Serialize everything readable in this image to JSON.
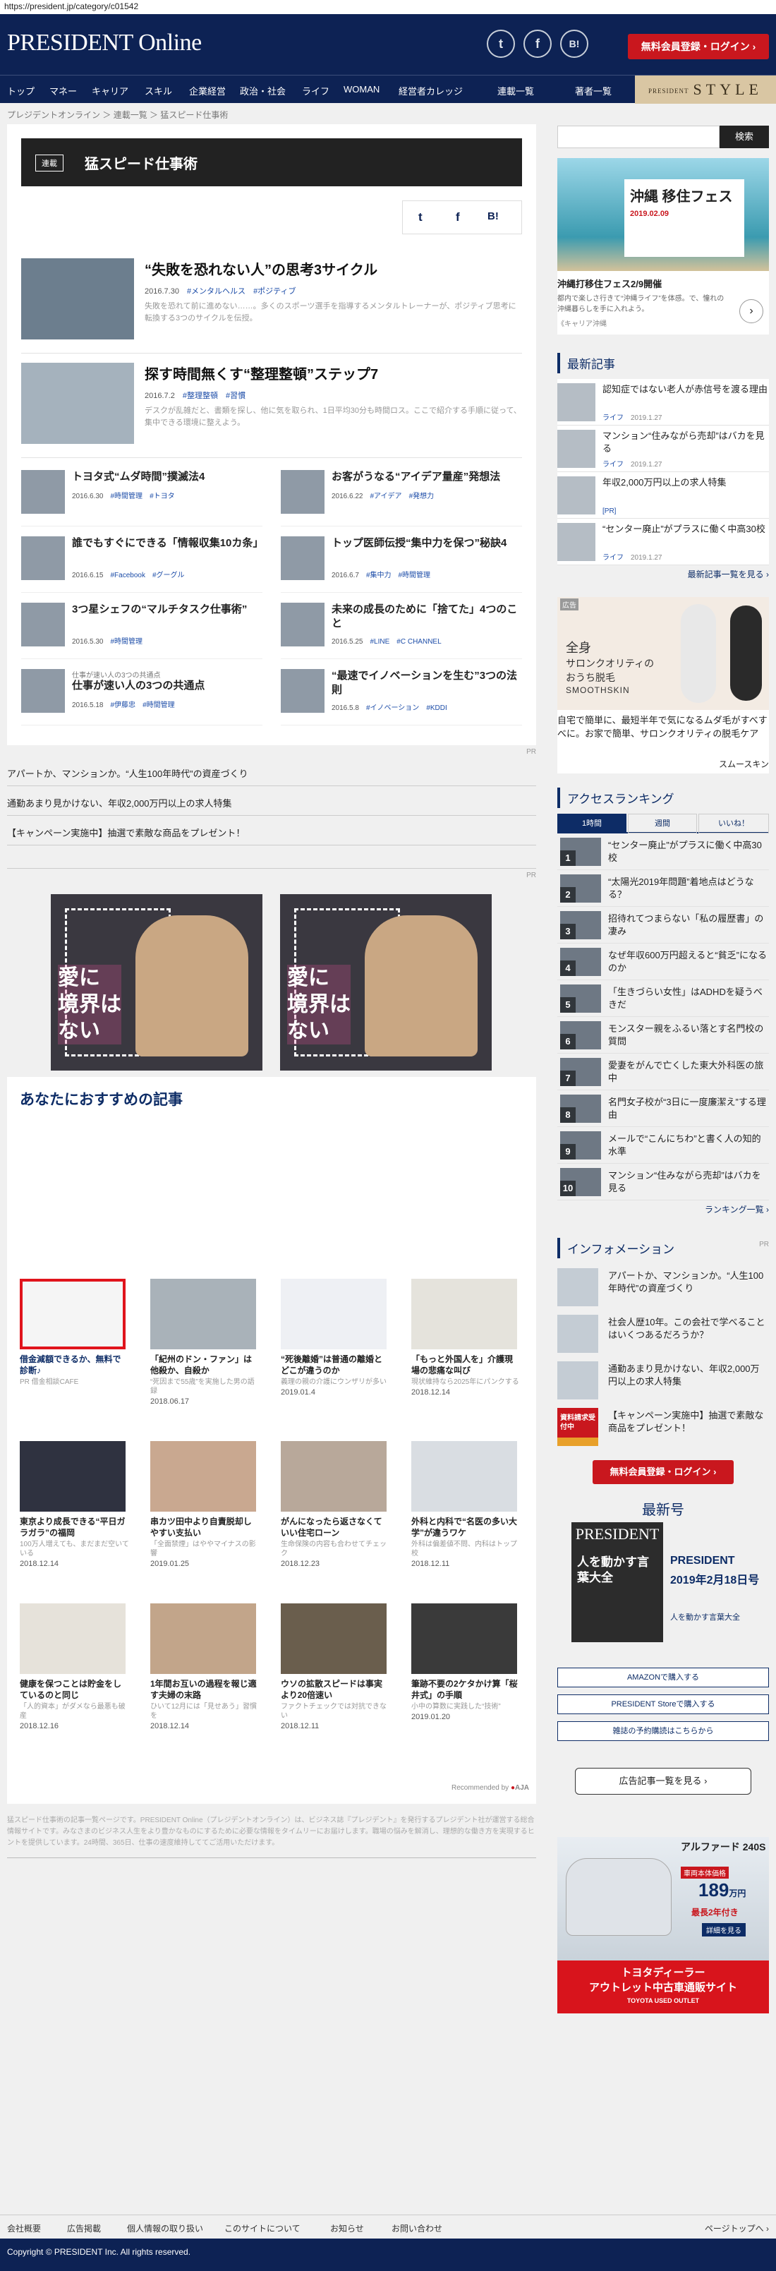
{
  "url": "https://president.jp/category/c01542",
  "header": {
    "logo": "PRESIDENT Online",
    "twitter": "t",
    "facebook": "f",
    "hatena": "B!",
    "login": "無料会員登録・ログイン ›"
  },
  "nav": {
    "items": [
      "トップ",
      "マネー",
      "キャリア",
      "スキル",
      "企業経営",
      "政治・社会",
      "ライフ",
      "WOMAN",
      "経営者カレッジ",
      "連載一覧",
      "著者一覧"
    ],
    "style": "STYLE",
    "style_small": "PRESIDENT"
  },
  "breadcrumb": [
    "プレジデントオンライン",
    "連載一覧",
    "猛スピード仕事術"
  ],
  "series": {
    "badge": "連載",
    "title": "猛スピード仕事術"
  },
  "share": {
    "twitter": "t",
    "facebook": "f",
    "hatena": "B!"
  },
  "featured": [
    {
      "title": "“失敗を恐れない人”の思考3サイクル",
      "date": "2016.7.30",
      "tags": [
        "#メンタルヘルス",
        "#ポジティブ"
      ],
      "desc": "失敗を恐れて前に進めない……。多くのスポーツ選手を指導するメンタルトレーナーが、ポジティブ思考に転換する3つのサイクルを伝授。"
    },
    {
      "title": "探す時間無くす“整理整頓”ステップ7",
      "date": "2016.7.2",
      "tags": [
        "#整理整頓",
        "#習慣"
      ],
      "desc": "デスクが乱雑だと、書類を探し、他に気を取られ、1日平均30分も時間ロス。ここで紹介する手順に従って、集中できる環境に整えよう。"
    }
  ],
  "articles": [
    {
      "title": "トヨタ式“ムダ時間”撲滅法4",
      "date": "2016.6.30",
      "tags": [
        "#時間管理",
        "#トヨタ"
      ],
      "sub": ""
    },
    {
      "title": "お客がうなる“アイデア量産”発想法",
      "date": "2016.6.22",
      "tags": [
        "#アイデア",
        "#発想力"
      ],
      "sub": ""
    },
    {
      "title": "誰でもすぐにできる「情報収集10カ条」",
      "date": "2016.6.15",
      "tags": [
        "#Facebook",
        "#グーグル"
      ],
      "sub": ""
    },
    {
      "title": "トップ医師伝授“集中力を保つ”秘訣4",
      "date": "2016.6.7",
      "tags": [
        "#集中力",
        "#時間管理"
      ],
      "sub": ""
    },
    {
      "title": "3つ星シェフの“マルチタスク仕事術”",
      "date": "2016.5.30",
      "tags": [
        "#時間管理"
      ],
      "sub": ""
    },
    {
      "title": "未来の成長のために「捨てた」4つのこと",
      "date": "2016.5.25",
      "tags": [
        "#LINE",
        "#C CHANNEL"
      ],
      "sub": ""
    },
    {
      "title": "仕事が速い人の3つの共通点",
      "date": "2016.5.18",
      "tags": [
        "#伊藤忠",
        "#時間管理"
      ],
      "sub": "仕事が速い人の3つの共通点"
    },
    {
      "title": "“最速でイノベーションを生む”3つの法則",
      "date": "2016.5.8",
      "tags": [
        "#イノベーション",
        "#KDDI"
      ],
      "sub": ""
    }
  ],
  "pr_label": "PR",
  "pr_links": [
    "アパートか、マンションか。“人生100年時代”の資産づくり",
    "通勤あまり見かけない、年収2,000万円以上の求人特集",
    "【キャンペーン実施中】抽選で素敵な商品をプレゼント！"
  ],
  "ad_banner": {
    "line1": "愛に",
    "line2": "境界は",
    "line3": "ない"
  },
  "recommend": {
    "title": "あなたにおすすめの記事",
    "credit": "Recommended by",
    "items": [
      {
        "title": "借金減額できるか、無料で診断♪",
        "src": "PR 借金相談CAFE",
        "date": ""
      },
      {
        "title": "「紀州のドン・ファン」は他殺か、自殺か",
        "src": "“死因まで55歳”を実施した男の語録",
        "date": "2018.06.17"
      },
      {
        "title": "“死後離婚”は普通の離婚とどこが違うのか",
        "src": "義理の親の介護にウンザリが多い",
        "date": "2019.01.4"
      },
      {
        "title": "「もっと外国人を」介護現場の悲痛な叫び",
        "src": "現状維持なら2025年にパンクする",
        "date": "2018.12.14"
      },
      {
        "title": "東京より成長できる“平日ガラガラ”の福岡",
        "src": "100万人増えても、まだまだ空いている",
        "date": "2018.12.14"
      },
      {
        "title": "串カツ田中より自責脱却しやすい支払い",
        "src": "「全面禁煙」はややマイナスの影響",
        "date": "2019.01.25"
      },
      {
        "title": "がんになったら返さなくていい住宅ローン",
        "src": "生命保険の内容も合わせてチェック",
        "date": "2018.12.23"
      },
      {
        "title": "外科と内科で“名医の多い大学”が違うワケ",
        "src": "外科は偏差値不問、内科はトップ校",
        "date": "2018.12.11"
      },
      {
        "title": "健康を保つことは貯金をしているのと同じ",
        "src": "「人的資本」がダメなら最悪も破産",
        "date": "2018.12.16"
      },
      {
        "title": "1年間お互いの過程を報じ適す夫婦の末路",
        "src": "ひいて12月には「見せあう」習慣を",
        "date": "2018.12.14"
      },
      {
        "title": "ウソの拡散スピードは事実より20倍速い",
        "src": "ファクトチェックでは対抗できない",
        "date": "2018.12.11"
      },
      {
        "title": "筆跡不要の2ケタかけ算「桜井式」の手順",
        "src": "小中の算数に実践した“技術”",
        "date": "2019.01.20"
      }
    ]
  },
  "note": "猛スピード仕事術の記事一覧ページです。PRESIDENT Online（プレジデントオンライン）は、ビジネス誌『プレジデント』を発行するプレジデント社が運営する総合情報サイトです。みなさまのビジネス人生をより豊かなものにするために必要な情報をタイムリーにお届けします。職場の悩みを解消し、理想的な働き方を実現するヒントを提供しています。24時間、365日、仕事の速度維持しててご活用いただけます。",
  "sidebar": {
    "search_btn": "検索",
    "okinawa": {
      "title": "沖縄 移住フェス",
      "date": "2019.02.09",
      "caption": "沖縄打移住フェス2/9開催",
      "desc": "都内で楽しさ行きて“沖縄ライフ”を体感。で、憧れの沖縄暮らしを手に入れよう。",
      "source": "《キャリア沖縄"
    },
    "latest_title": "最新記事",
    "latest": [
      {
        "title": "認知症ではない老人が赤信号を渡る理由",
        "cat": "ライフ",
        "date": "2019.1.27"
      },
      {
        "title": "マンション“住みながら売却”はバカを見る",
        "cat": "ライフ",
        "date": "2019.1.27"
      },
      {
        "title": "年収2,000万円以上の求人特集",
        "cat": "[PR]",
        "date": ""
      },
      {
        "title": "“センター廃止”がプラスに働く中高30校",
        "cat": "ライフ",
        "date": "2019.1.27"
      }
    ],
    "latest_more": "最新記事一覧を見る ›",
    "ad2": {
      "label": "広告",
      "line1": "全身",
      "line2": "サロンクオリティの",
      "line3": "おうち脱毛",
      "brand": "SMOOTHSKIN",
      "desc": "自宅で簡単に、最短半年で気になるムダ毛がすべすべに。お家で簡単、サロンクオリティの脱毛ケア",
      "sponsor": "スムースキン"
    },
    "ranking_title": "アクセスランキング",
    "ranking_tabs": [
      "1時間",
      "週間",
      "いいね！"
    ],
    "ranking": [
      "“センター廃止”がプラスに働く中高30校",
      "“太陽光2019年問題”着地点はどうなる？",
      "招待れてつまらない「私の履歴書」の凄み",
      "なぜ年収600万円超えると“貧乏”になるのか",
      "「生きづらい女性」はADHDを疑うべきだ",
      "モンスター親をふるい落とす名門校の質問",
      "愛妻をがんで亡くした東大外科医の旅中",
      "名門女子校が“3日に一度廉潔え”する理由",
      "メールで“こんにちわ”と書く人の知的水準",
      "マンション“住みながら売却”はバカを見る"
    ],
    "ranking_more": "ランキング一覧 ›",
    "info_title": "インフォメーション",
    "info": [
      "アパートか、マンションか。“人生100年時代”の資産づくり",
      "社会人歴10年。この会社で学べることはいくつあるだろうか？",
      "通勤あまり見かけない、年収2,000万円以上の求人特集",
      "【キャンペーン実施中】抽選で素敵な商品をプレゼント！"
    ],
    "info_badge": "資料請求受付中",
    "login": "無料会員登録・ログイン ›",
    "issue_title": "最新号",
    "issue": {
      "mag": "PRESIDENT",
      "name": "PRESIDENT",
      "date": "2019年2月18日号",
      "cover_text": "人を動かす言葉大全",
      "link": "人を動かす言葉大全"
    },
    "buy": [
      "AMAZONで購入する",
      "PRESIDENT Storeで購入する",
      "雑誌の予約購読はこちらから"
    ],
    "ad_list": "広告記事一覧を見る ›",
    "car": {
      "brand": "アルファード 240S",
      "price_label": "車両本体価格",
      "price": "189",
      "unit": "万円",
      "note": "最長2年付き",
      "detail": "詳細を見る",
      "title": "トヨタディーラー",
      "sub": "アウトレット中古車通販サイト",
      "logo": "TOYOTA",
      "logo2": "USED OUTLET"
    }
  },
  "footer": {
    "links": [
      "会社概要",
      "広告掲載",
      "個人情報の取り扱い",
      "このサイトについて",
      "お知らせ",
      "お問い合わせ"
    ],
    "pagetop": "ページトップへ ›",
    "copyright": "Copyright © PRESIDENT Inc. All rights reserved."
  }
}
